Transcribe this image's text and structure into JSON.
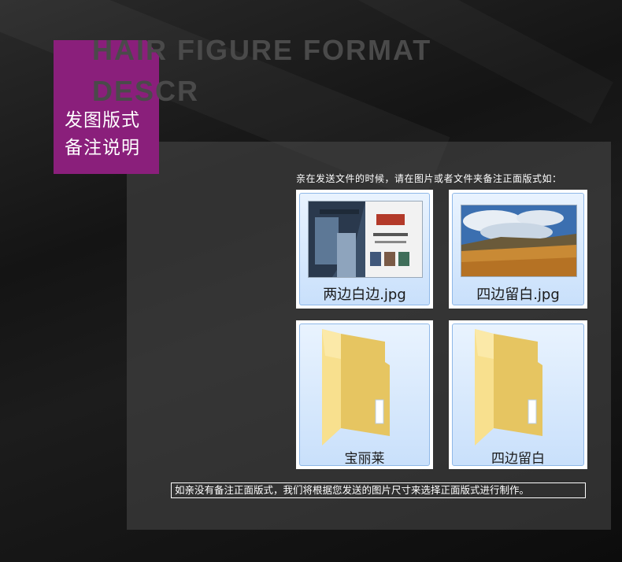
{
  "header": {
    "english_title": "HAIR FIGURE FORMAT DESCR",
    "badge_line1": "发图版式",
    "badge_line2": "备注说明"
  },
  "instruction": "亲在发送文件的时候，请在图片或者文件夹备注正面版式如：",
  "files": [
    {
      "label": "两边白边.jpg",
      "icon": "photo-thumbnail-collage-icon"
    },
    {
      "label": "四边留白.jpg",
      "icon": "photo-thumbnail-landscape-icon"
    }
  ],
  "folders": [
    {
      "label": "宝丽莱",
      "icon": "folder-icon"
    },
    {
      "label": "四边留白",
      "icon": "folder-icon"
    }
  ],
  "note": "如亲没有备注正面版式，我们将根据您发送的图片尺寸来选择正面版式进行制作。",
  "colors": {
    "badge": "#8a1f7b",
    "selection_fill": "#cfe3fc",
    "selection_border": "#8fb8e8",
    "folder": "#f5d97a"
  }
}
